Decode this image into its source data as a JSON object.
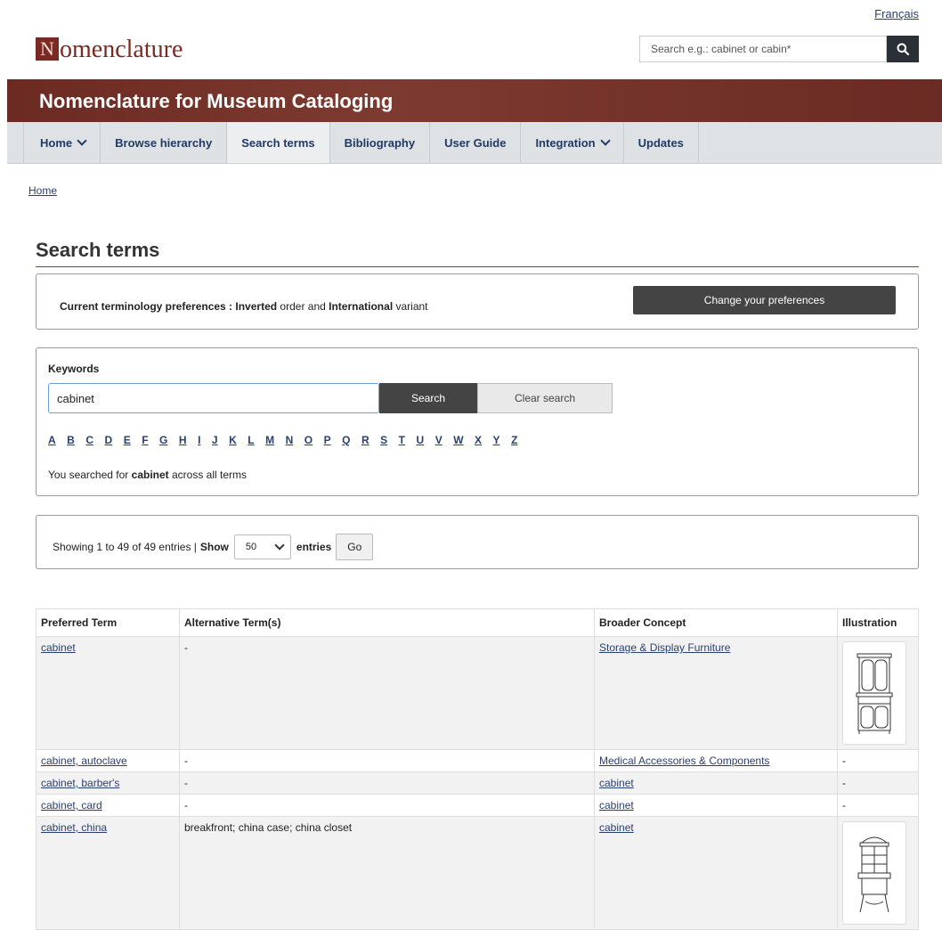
{
  "header": {
    "language_link": "Français",
    "logo_initial": "N",
    "logo_rest": "omenclature",
    "search_placeholder": "Search e.g.: cabinet or cabin*",
    "banner_title": "Nomenclature for Museum Cataloging"
  },
  "nav": {
    "items": [
      {
        "label": "Home",
        "dropdown": true
      },
      {
        "label": "Browse hierarchy"
      },
      {
        "label": "Search terms",
        "active": true
      },
      {
        "label": "Bibliography"
      },
      {
        "label": "User Guide"
      },
      {
        "label": "Integration",
        "dropdown": true
      },
      {
        "label": "Updates"
      }
    ]
  },
  "breadcrumb": "Home",
  "page_title": "Search terms",
  "preferences": {
    "label": "Current terminology preferences :",
    "order": "Inverted",
    "order_suffix": "order and",
    "variant": "International",
    "variant_suffix": "variant",
    "button": "Change your preferences"
  },
  "search": {
    "label": "Keywords",
    "value": "cabinet",
    "search_button": "Search",
    "clear_button": "Clear search",
    "alphabet": [
      "A",
      "B",
      "C",
      "D",
      "E",
      "F",
      "G",
      "H",
      "I",
      "J",
      "K",
      "L",
      "M",
      "N",
      "O",
      "P",
      "Q",
      "R",
      "S",
      "T",
      "U",
      "V",
      "W",
      "X",
      "Y",
      "Z"
    ],
    "result_prefix": "You searched for",
    "result_term": "cabinet",
    "result_suffix": "across all terms"
  },
  "entries": {
    "showing": "Showing 1 to 49 of 49 entries |",
    "show_label": "Show",
    "page_size": "50",
    "entries_label": "entries",
    "go_button": "Go"
  },
  "table": {
    "headers": [
      "Preferred Term",
      "Alternative Term(s)",
      "Broader Concept",
      "Illustration"
    ],
    "rows": [
      {
        "term": "cabinet",
        "alt": "-",
        "broader": "Storage & Display Furniture",
        "illustration": "cabinet-illustration"
      },
      {
        "term": "cabinet, autoclave",
        "alt": "-",
        "broader": "Medical Accessories & Components",
        "illustration": "-"
      },
      {
        "term": "cabinet, barber's",
        "alt": "-",
        "broader": "cabinet",
        "illustration": "-"
      },
      {
        "term": "cabinet, card",
        "alt": "-",
        "broader": "cabinet",
        "illustration": "-"
      },
      {
        "term": "cabinet, china",
        "alt": "breakfront; china case; china closet",
        "broader": "cabinet",
        "illustration": "china-cabinet-illustration"
      }
    ]
  }
}
